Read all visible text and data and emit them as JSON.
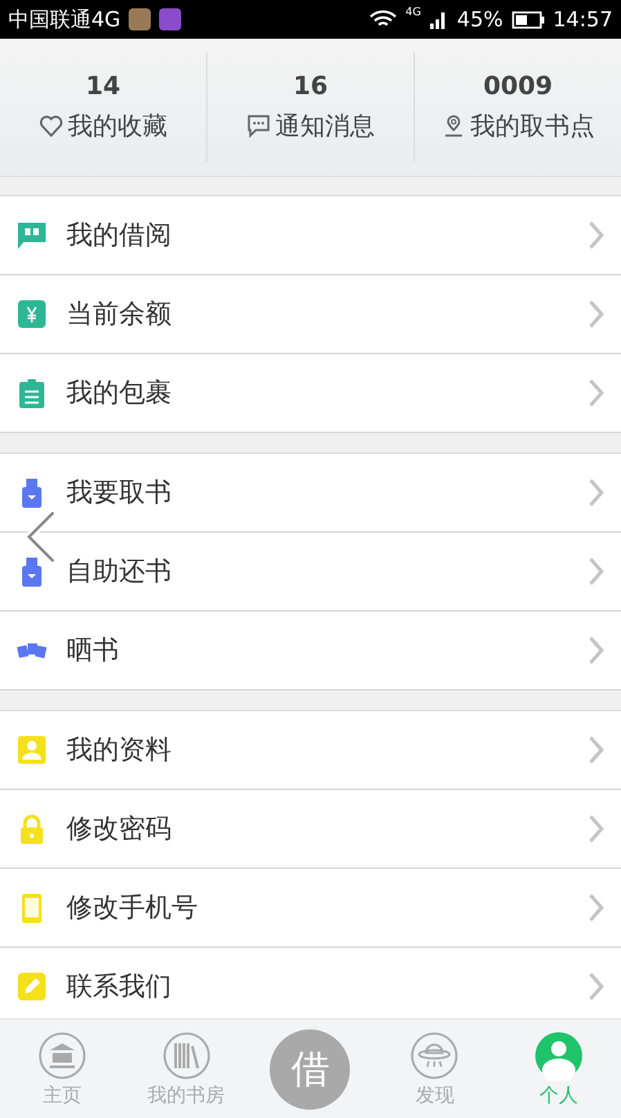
{
  "status_bar": {
    "carrier": "中国联通4G",
    "network": "4G",
    "battery": "45%",
    "time": "14:57"
  },
  "stats": [
    {
      "value": "14",
      "label": "我的收藏",
      "kind": "heart"
    },
    {
      "value": "16",
      "label": "通知消息",
      "kind": "message"
    },
    {
      "value": "0009",
      "label": "我的取书点",
      "kind": "pin"
    }
  ],
  "groups": [
    {
      "items": [
        {
          "label": "我的借阅",
          "kind": "book",
          "color": "#2db795"
        },
        {
          "label": "当前余额",
          "kind": "yuan",
          "color": "#2db795"
        },
        {
          "label": "我的包裹",
          "kind": "clipboard",
          "color": "#2db795"
        }
      ]
    },
    {
      "items": [
        {
          "label": "我要取书",
          "kind": "bottle",
          "color": "#5b77f0"
        },
        {
          "label": "自助还书",
          "kind": "bottle",
          "color": "#5b77f0"
        },
        {
          "label": "晒书",
          "kind": "cards",
          "color": "#5b77f0"
        }
      ]
    },
    {
      "items": [
        {
          "label": "我的资料",
          "kind": "person",
          "color": "#f5e01c"
        },
        {
          "label": "修改密码",
          "kind": "lock",
          "color": "#f5e01c"
        },
        {
          "label": "修改手机号",
          "kind": "phone",
          "color": "#f5e01c"
        },
        {
          "label": "联系我们",
          "kind": "pencil",
          "color": "#f5e01c"
        }
      ]
    }
  ],
  "tab_bar": [
    {
      "label": "主页",
      "kind": "home",
      "selected": false
    },
    {
      "label": "我的书房",
      "kind": "books",
      "selected": false
    },
    {
      "label": "借",
      "kind": "center",
      "selected": false
    },
    {
      "label": "发现",
      "kind": "ufo",
      "selected": false
    },
    {
      "label": "个人",
      "kind": "person",
      "selected": true
    }
  ]
}
